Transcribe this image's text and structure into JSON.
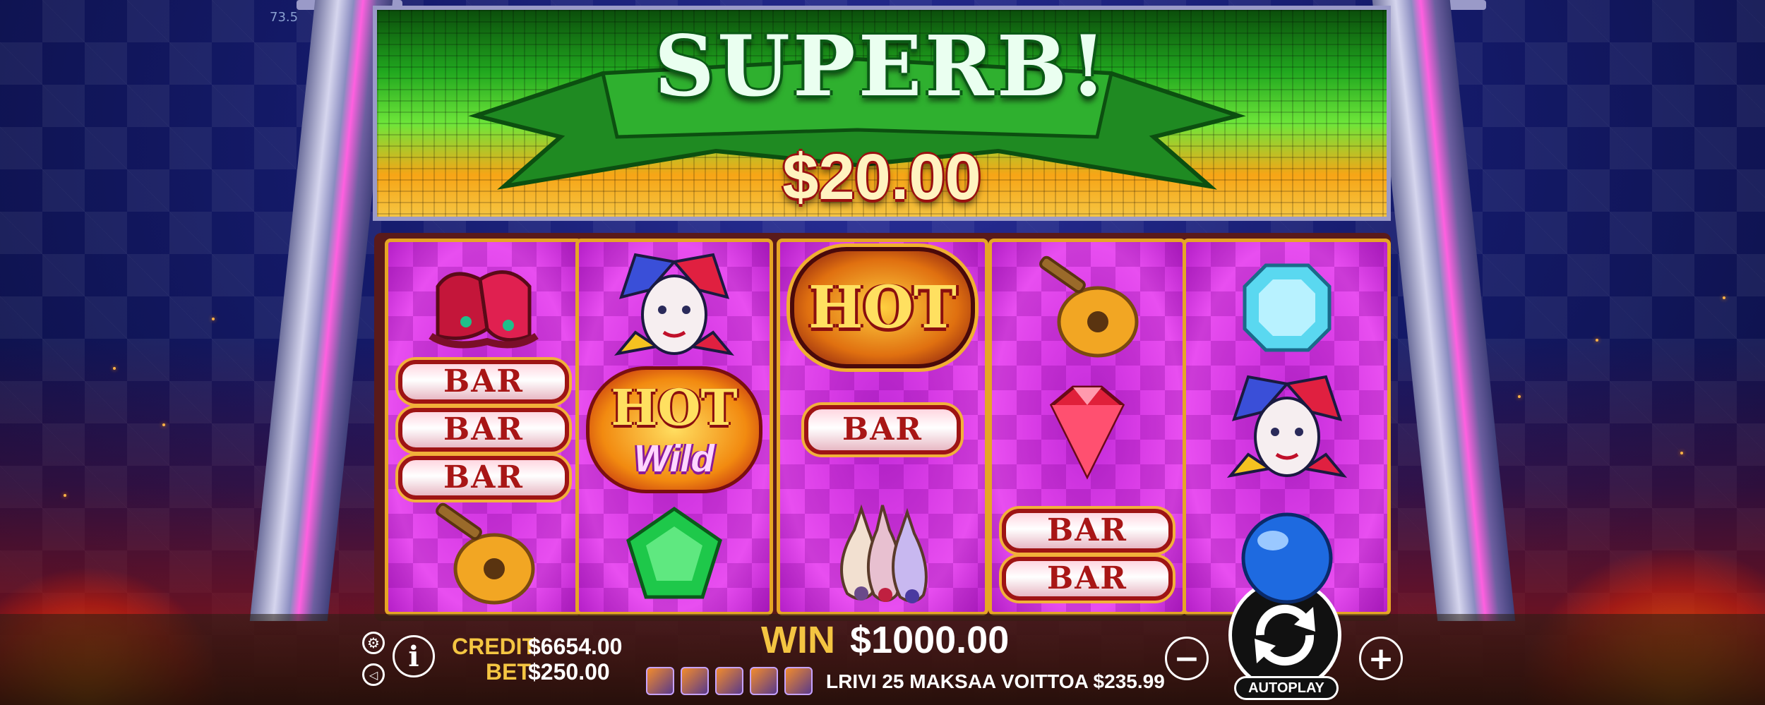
{
  "top_left_text": "73.5",
  "banner": {
    "title": "SUPERB!",
    "amount": "$20.00"
  },
  "reels": [
    {
      "symbols": [
        "jester-boots",
        "bar-3",
        "lute"
      ]
    },
    {
      "symbols": [
        "jester-mask",
        "hot-wild",
        "emerald"
      ]
    },
    {
      "symbols": [
        "hot",
        "bar-1",
        "juggling-pins"
      ]
    },
    {
      "symbols": [
        "lute",
        "ruby",
        "bar-2"
      ]
    },
    {
      "symbols": [
        "diamond",
        "jester-mask",
        "blue-orb"
      ]
    }
  ],
  "symbol_text": {
    "bar": "BAR",
    "hot": "HOT",
    "hot_wild_top": "HOT",
    "hot_wild_bottom": "Wild"
  },
  "hud": {
    "credit_label": "CREDIT",
    "credit_value": "$6654.00",
    "bet_label": "BET",
    "bet_value": "$250.00",
    "win_label": "WIN",
    "win_value": "$1000.00",
    "line_info": "LRIVI 25 MAKSAA VOITTOA $235.99",
    "autoplay_label": "AUTOPLAY",
    "info_label": "i",
    "minus_label": "−",
    "plus_label": "+"
  },
  "colors": {
    "reel_bg": "#d93ce6",
    "reel_border": "#e6a526",
    "banner_green": "#21a81f",
    "win_yellow": "#f4c542"
  }
}
